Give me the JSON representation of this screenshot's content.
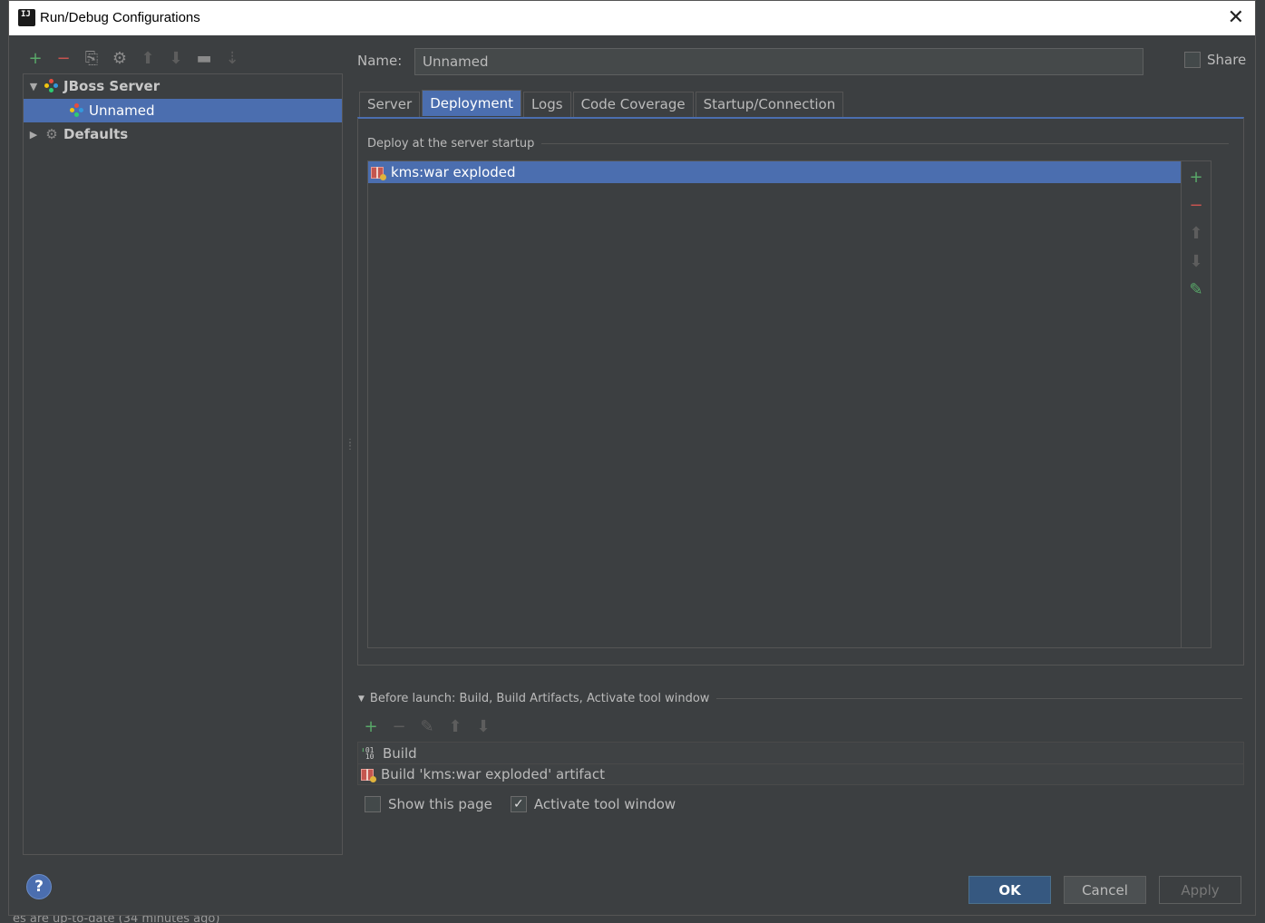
{
  "window": {
    "title": "Run/Debug Configurations",
    "app_icon_text": "IJ"
  },
  "background": {
    "status_text": "es are up-to-date (34 minutes ago)"
  },
  "left_toolbar": {
    "add": "+",
    "remove": "−",
    "copy": "⎘",
    "edit_defaults": "⚙",
    "move_up": "⬆",
    "move_down": "⬇",
    "folder": "▬",
    "sort": "⇣"
  },
  "tree": {
    "items": [
      {
        "label": "JBoss Server",
        "expanded": true,
        "icon": "jboss-icon"
      },
      {
        "label": "Unnamed",
        "selected": true,
        "icon": "jboss-icon"
      },
      {
        "label": "Defaults",
        "expanded": false,
        "icon": "wrench-icon"
      }
    ]
  },
  "name": {
    "label": "Name:",
    "value": "Unnamed"
  },
  "share": {
    "label": "Share",
    "checked": false
  },
  "tabs": [
    {
      "label": "Server",
      "active": false
    },
    {
      "label": "Deployment",
      "active": true
    },
    {
      "label": "Logs",
      "active": false
    },
    {
      "label": "Code Coverage",
      "active": false
    },
    {
      "label": "Startup/Connection",
      "active": false
    }
  ],
  "deployment": {
    "section_title": "Deploy at the server startup",
    "items": [
      {
        "label": "kms:war exploded",
        "selected": true
      }
    ]
  },
  "before_launch": {
    "title": "Before launch: Build, Build Artifacts, Activate tool window",
    "items": [
      {
        "label": "Build"
      },
      {
        "label": "Build 'kms:war exploded' artifact"
      }
    ]
  },
  "options": {
    "show_this_page": {
      "label": "Show this page",
      "checked": false
    },
    "activate_tool_window": {
      "label": "Activate tool window",
      "checked": true
    }
  },
  "buttons": {
    "help": "?",
    "ok": "OK",
    "cancel": "Cancel",
    "apply": "Apply"
  },
  "colors": {
    "selection": "#4b6eaf",
    "panel": "#3c3f41",
    "green": "#59a869",
    "red": "#c75450"
  }
}
